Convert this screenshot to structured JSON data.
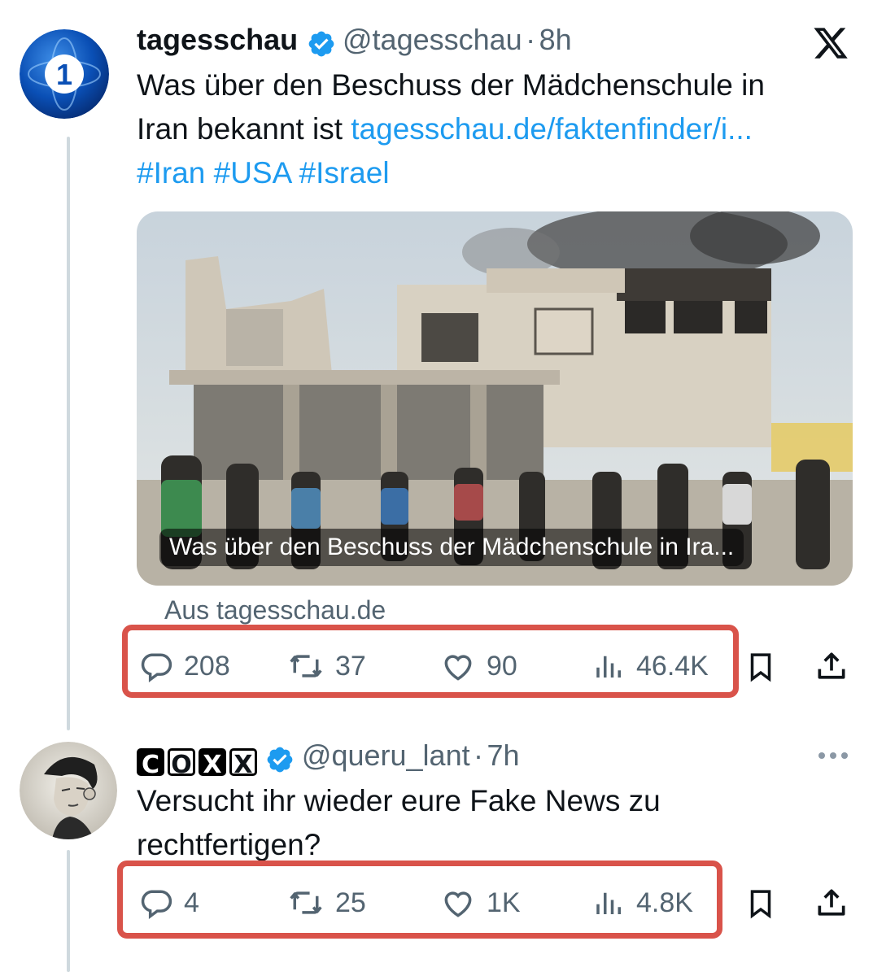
{
  "tweet1": {
    "display_name": "tagesschau",
    "handle": "@tagesschau",
    "separator": "·",
    "time": "8h",
    "text_line1": "Was über den Beschuss der Mädchenschule in",
    "text_line2_prefix": "Iran bekannt ist ",
    "link": "tagesschau.de/faktenfinder/i...",
    "hashtags": "#Iran #USA #Israel",
    "card_caption": "Was über den Beschuss der Mädchenschule in Ira...",
    "card_source": "Aus tagesschau.de",
    "replies": "208",
    "reposts": "37",
    "likes": "90",
    "views": "46.4K"
  },
  "tweet2": {
    "display_name_letters": [
      "C",
      "O",
      "X",
      "X"
    ],
    "handle": "@queru_lant",
    "separator": "·",
    "time": "7h",
    "text_line1": "Versucht ihr wieder eure Fake News zu",
    "text_line2": "rechtfertigen?",
    "replies": "4",
    "reposts": "25",
    "likes": "1K",
    "views": "4.8K"
  },
  "colors": {
    "highlight": "#d9534a",
    "link": "#1d9bf0",
    "muted": "#536471",
    "verified": "#1d9bf0"
  },
  "icons": [
    "x-logo-icon",
    "verified-badge-icon",
    "reply-icon",
    "repost-icon",
    "like-icon",
    "views-icon",
    "bookmark-icon",
    "share-icon",
    "more-icon"
  ]
}
